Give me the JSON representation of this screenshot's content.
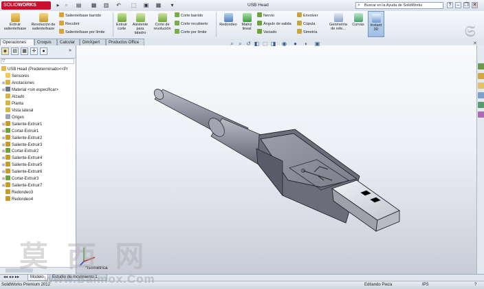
{
  "app": {
    "brand": "SOLIDWORKS",
    "brand_prefix": "SOLID",
    "brand_suffix": "WORKS",
    "window_title": "USB Head",
    "search_placeholder": "Buscar en la Ayuda de SolidWorks"
  },
  "ribbon": {
    "extruir_saliente": "Extruir saliente/base",
    "revolucion_saliente": "Revolución de saliente/base",
    "saliente_barrido": "Saliente/base barrido",
    "recubrir": "Recubrir",
    "saliente_limite": "Saliente/base por límite",
    "extruir_corte": "Extruir corte",
    "asistente_taladro": "Asistente para taladro",
    "corte_revolucion": "Corte de revolución",
    "corte_barrido": "Corte barrido",
    "corte_recubierto": "Corte recubierto",
    "corte_limite": "Corte por límite",
    "redondeo": "Redondeo",
    "matriz_lineal": "Matriz lineal",
    "nervio": "Nervio",
    "angulo_salida": "Ángulo de salida",
    "vaciado": "Vaciado",
    "envolver": "Envolver",
    "cupula": "Cúpula",
    "simetria": "Simetría",
    "geometria_ref": "Geometría de refe...",
    "curvas": "Curvas",
    "instant3d": "Instant 3D"
  },
  "tabs": [
    "Operaciones",
    "Croquis",
    "Calcular",
    "DimXpert",
    "Productos Office"
  ],
  "tree": {
    "root": "USB Head  (Predeterminado<<Pr",
    "items": [
      "Sensores",
      "Anotaciones",
      "Material <sin especificar>",
      "Alzado",
      "Planta",
      "Vista lateral",
      "Origen",
      "Saliente-Extruir1",
      "Cortar-Extruir1",
      "Saliente-Extruir2",
      "Saliente-Extruir3",
      "Cortar-Extruir2",
      "Saliente-Extruir4",
      "Saliente-Extruir5",
      "Saliente-Extruir6",
      "Cortar-Extruir3",
      "Saliente-Extruir7",
      "Redondeo3",
      "Redondeo4"
    ]
  },
  "viewport": {
    "view_label": "*Isométrica"
  },
  "model_tabs": [
    "Modelo",
    "Estudio de movimiento 1"
  ],
  "status": {
    "product": "SolidWorks Premium 2012",
    "mode": "Editando Pieza",
    "units": "IPS",
    "help": "?"
  },
  "watermark": {
    "chars": "莫 西 网",
    "url": "www.Baimox.Com"
  },
  "colors": {
    "brand_red": "#c8102e",
    "viewport_top": "#f9fafc",
    "viewport_bottom": "#c8ccd8",
    "model_gray": "#7d7f8a"
  }
}
